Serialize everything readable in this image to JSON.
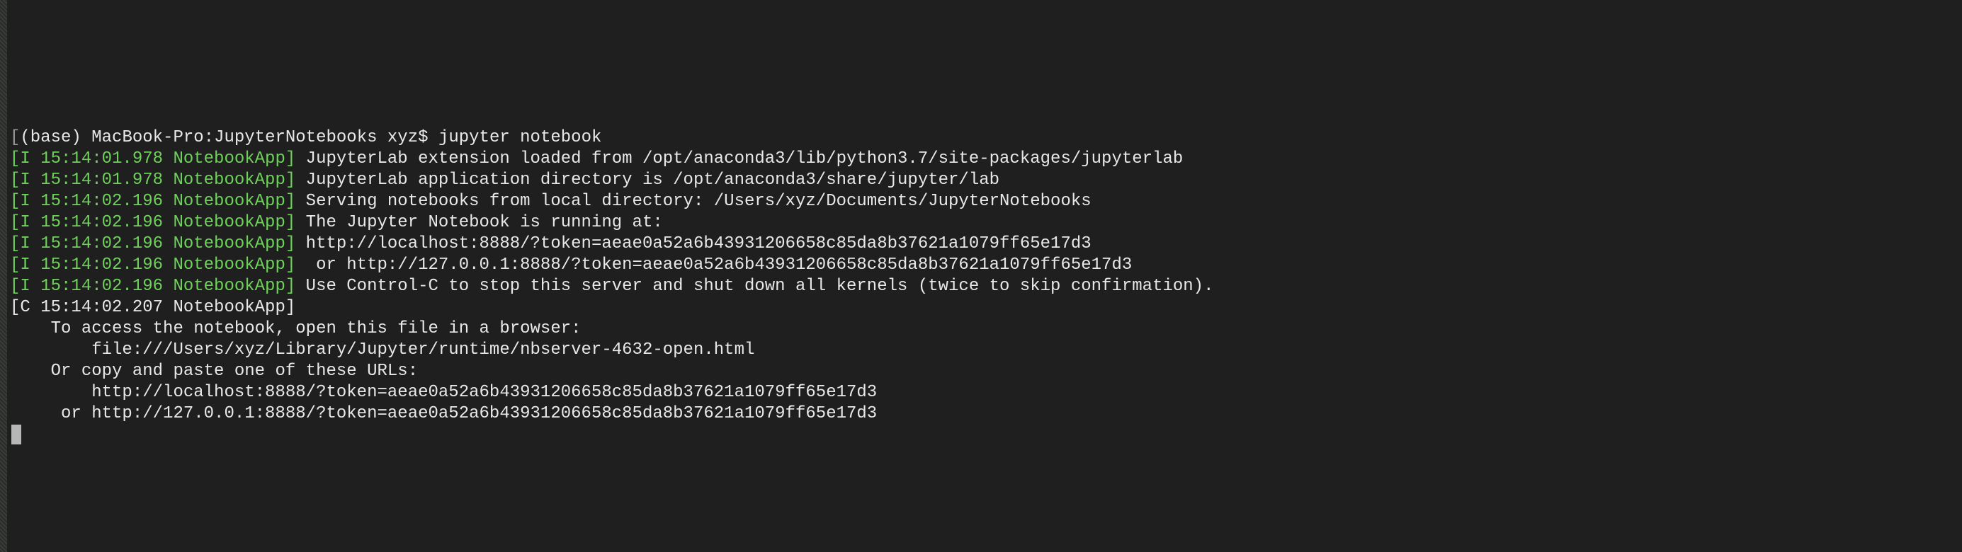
{
  "prompt": {
    "env": "(base)",
    "host_path": "MacBook-Pro:JupyterNotebooks",
    "user": "xyz",
    "sep": "$",
    "command": "jupyter notebook"
  },
  "log": {
    "lines": [
      {
        "level": "I",
        "ts": "15:14:01.978",
        "src": "NotebookApp",
        "msg": "JupyterLab extension loaded from /opt/anaconda3/lib/python3.7/site-packages/jupyterlab",
        "green": true
      },
      {
        "level": "I",
        "ts": "15:14:01.978",
        "src": "NotebookApp",
        "msg": "JupyterLab application directory is /opt/anaconda3/share/jupyter/lab",
        "green": true
      },
      {
        "level": "I",
        "ts": "15:14:02.196",
        "src": "NotebookApp",
        "msg": "Serving notebooks from local directory: /Users/xyz/Documents/JupyterNotebooks",
        "green": true
      },
      {
        "level": "I",
        "ts": "15:14:02.196",
        "src": "NotebookApp",
        "msg": "The Jupyter Notebook is running at:",
        "green": true
      },
      {
        "level": "I",
        "ts": "15:14:02.196",
        "src": "NotebookApp",
        "msg": "http://localhost:8888/?token=aeae0a52a6b43931206658c85da8b37621a1079ff65e17d3",
        "green": true
      },
      {
        "level": "I",
        "ts": "15:14:02.196",
        "src": "NotebookApp",
        "msg": " or http://127.0.0.1:8888/?token=aeae0a52a6b43931206658c85da8b37621a1079ff65e17d3",
        "green": true
      },
      {
        "level": "I",
        "ts": "15:14:02.196",
        "src": "NotebookApp",
        "msg": "Use Control-C to stop this server and shut down all kernels (twice to skip confirmation).",
        "green": true
      },
      {
        "level": "C",
        "ts": "15:14:02.207",
        "src": "NotebookApp",
        "msg": "",
        "green": false
      }
    ]
  },
  "body": {
    "blank": "",
    "l1": "    To access the notebook, open this file in a browser:",
    "l2": "        file:///Users/xyz/Library/Jupyter/runtime/nbserver-4632-open.html",
    "l3": "    Or copy and paste one of these URLs:",
    "l4": "        http://localhost:8888/?token=aeae0a52a6b43931206658c85da8b37621a1079ff65e17d3",
    "l5": "     or http://127.0.0.1:8888/?token=aeae0a52a6b43931206658c85da8b37621a1079ff65e17d3"
  }
}
